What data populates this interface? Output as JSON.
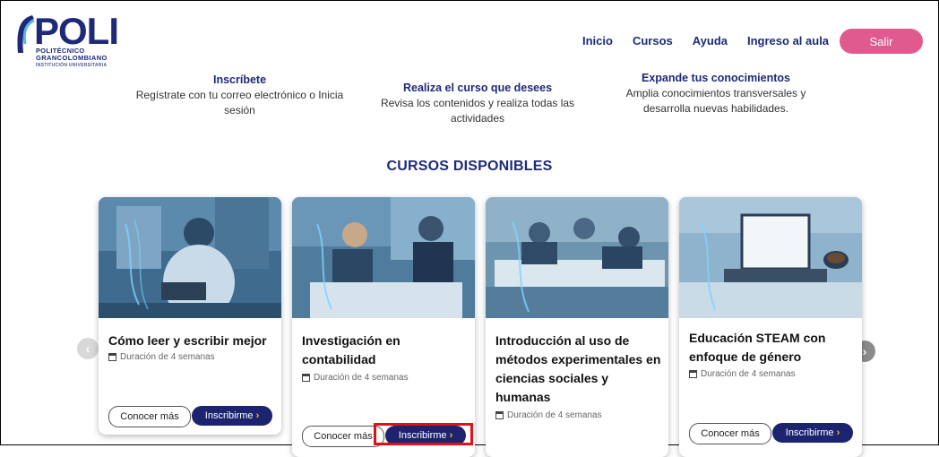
{
  "brand": {
    "logo_word": "POLI",
    "logo_line1": "POLITÉCNICO",
    "logo_line2": "GRANCOLOMBIANO",
    "logo_line3": "INSTITUCIÓN UNIVERSITARIA"
  },
  "nav": {
    "items": [
      "Inicio",
      "Cursos",
      "Ayuda",
      "Ingreso al aula"
    ],
    "logout_label": "Salir"
  },
  "steps": [
    {
      "title": "Inscríbete",
      "text": "Regístrate con tu correo electrónico o Inicia sesión"
    },
    {
      "title": "Realiza el curso que desees",
      "text": "Revisa los contenidos y realiza todas las actividades"
    },
    {
      "title": "Expande tus conocimientos",
      "text": "Amplia conocimientos transversales y desarrolla nuevas habilidades."
    }
  ],
  "section_title": "CURSOS DISPONIBLES",
  "courses": [
    {
      "title": "Cómo leer y escribir mejor",
      "duration": "Duración de 4 semanas",
      "more_label": "Conocer más",
      "enroll_label": "Inscribirme"
    },
    {
      "title": "Investigación en contabilidad",
      "duration": "Duración de 4 semanas",
      "more_label": "Conocer más",
      "enroll_label": "Inscribirme"
    },
    {
      "title": "Introducción al uso de métodos experimentales en ciencias sociales y humanas",
      "duration": "Duración de 4 semanas"
    },
    {
      "title": "Educación STEAM con enfoque de género",
      "duration": "Duración de 4 semanas",
      "more_label": "Conocer más",
      "enroll_label": "Inscribirme"
    }
  ],
  "colors": {
    "brand_navy": "#1e2a78",
    "button_navy": "#1c2470",
    "accent_pink": "#e05a8f",
    "chevron_yellow": "#f5c518",
    "highlight_red": "#e0101a"
  }
}
